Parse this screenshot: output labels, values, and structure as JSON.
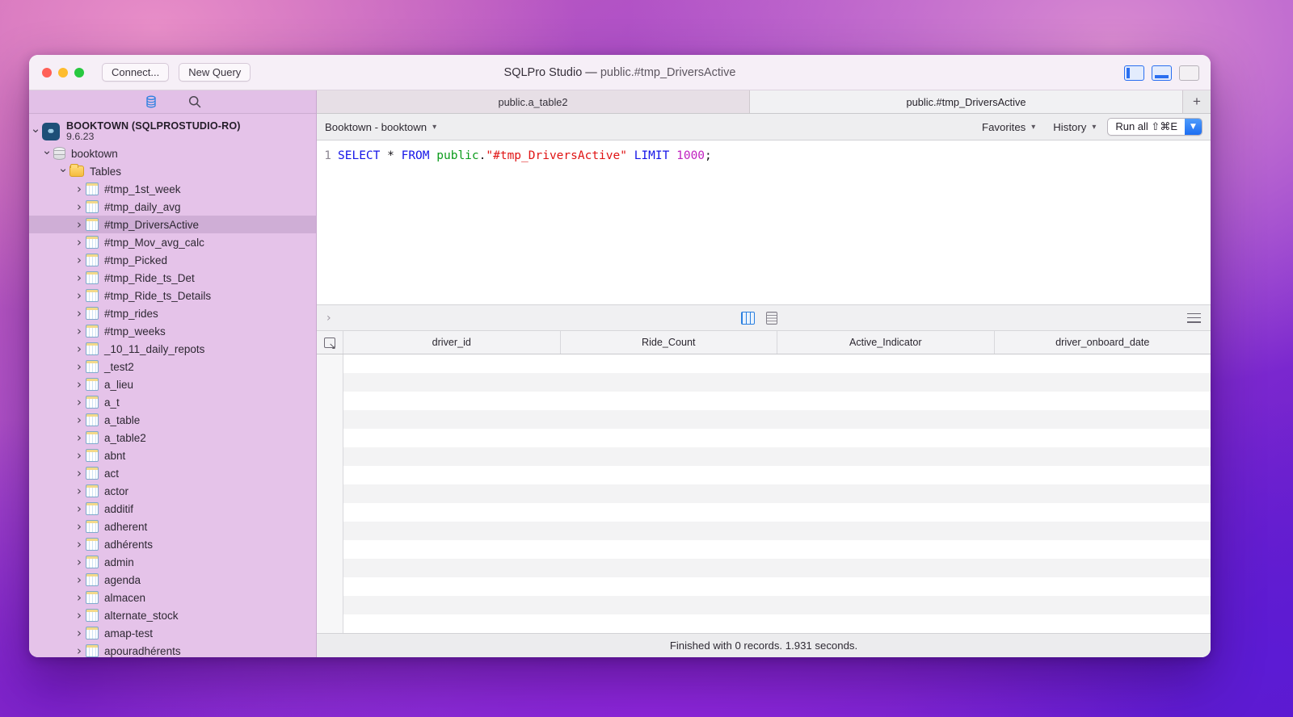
{
  "window": {
    "title_app": "SQLPro Studio — ",
    "title_doc": "public.#tmp_DriversActive",
    "buttons": {
      "connect": "Connect...",
      "new_query": "New Query"
    },
    "panel_toggles": [
      {
        "name": "left-sidebar-toggle",
        "active": true
      },
      {
        "name": "bottom-panel-toggle",
        "active": true
      },
      {
        "name": "right-sidebar-toggle",
        "active": false
      }
    ]
  },
  "sidebar": {
    "header_icons": [
      "database-icon",
      "search-icon"
    ],
    "connection": {
      "name": "BOOKTOWN (SQLPROSTUDIO-RO)",
      "version": "9.6.23"
    },
    "database": "booktown",
    "group": "Tables",
    "selected_table": "#tmp_DriversActive",
    "tables": [
      "#tmp_1st_week",
      "#tmp_daily_avg",
      "#tmp_DriversActive",
      "#tmp_Mov_avg_calc",
      "#tmp_Picked",
      "#tmp_Ride_ts_Det",
      "#tmp_Ride_ts_Details",
      "#tmp_rides",
      "#tmp_weeks",
      "_10_11_daily_repots",
      "_test2",
      "a_lieu",
      "a_t",
      "a_table",
      "a_table2",
      "abnt",
      "act",
      "actor",
      "additif",
      "adherent",
      "adhérents",
      "admin",
      "agenda",
      "almacen",
      "alternate_stock",
      "amap-test",
      "apouradhérents"
    ]
  },
  "tabs": [
    {
      "label": "public.a_table2",
      "active": false
    },
    {
      "label": "public.#tmp_DriversActive",
      "active": true
    }
  ],
  "tab_add_label": "+",
  "query_toolbar": {
    "connection_select": "Booktown - booktown",
    "favorites": "Favorites",
    "history": "History",
    "run_all": "Run all ⇧⌘E"
  },
  "editor": {
    "line_number": "1",
    "tokens": [
      {
        "t": "SELECT",
        "c": "k"
      },
      {
        "t": " ",
        "c": "sp"
      },
      {
        "t": "*",
        "c": "op"
      },
      {
        "t": " ",
        "c": "sp"
      },
      {
        "t": "FROM",
        "c": "k"
      },
      {
        "t": " ",
        "c": "sp"
      },
      {
        "t": "public",
        "c": "sch"
      },
      {
        "t": ".",
        "c": "pun"
      },
      {
        "t": "\"#tmp_DriversActive\"",
        "c": "str"
      },
      {
        "t": " ",
        "c": "sp"
      },
      {
        "t": "LIMIT",
        "c": "k"
      },
      {
        "t": " ",
        "c": "sp"
      },
      {
        "t": "1000",
        "c": "num"
      },
      {
        "t": ";",
        "c": "pun"
      }
    ]
  },
  "results_toolbar": {
    "expand_icon": "chevron-right-icon",
    "grid_view_icon": "grid-view-icon",
    "message_view_icon": "message-view-icon",
    "menu_icon": "hamburger-menu-icon"
  },
  "results": {
    "columns": [
      "driver_id",
      "Ride_Count",
      "Active_Indicator",
      "driver_onboard_date"
    ],
    "rows": [],
    "empty_row_count": 15
  },
  "status_bar": {
    "text": "Finished with 0 records. 1.931 seconds."
  },
  "colors": {
    "accent_blue": "#2a6ff0",
    "sidebar_bg": "#e5c3e9",
    "selection": "#cfaed6",
    "keyword": "#1515e8",
    "schema": "#0c9c1c",
    "string": "#e01414",
    "number": "#c020c0"
  }
}
